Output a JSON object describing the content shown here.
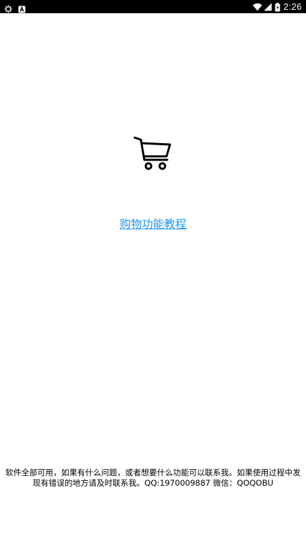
{
  "status_bar": {
    "time": "2:26",
    "left_icons": [
      "settings-gear-icon",
      "notification-a-icon"
    ],
    "right_icons": [
      "wifi-icon",
      "signal-icon",
      "battery-icon"
    ]
  },
  "main": {
    "icon": "shopping-cart-icon",
    "tutorial_link": "购物功能教程",
    "link_color": "#2196F3"
  },
  "footer": {
    "note": "软件全部可用，如果有什么问题，或者想要什么功能可以联系我。如果使用过程中发现有错误的地方请及时联系我。QQ:1970009887  微信：QOQOBU"
  }
}
